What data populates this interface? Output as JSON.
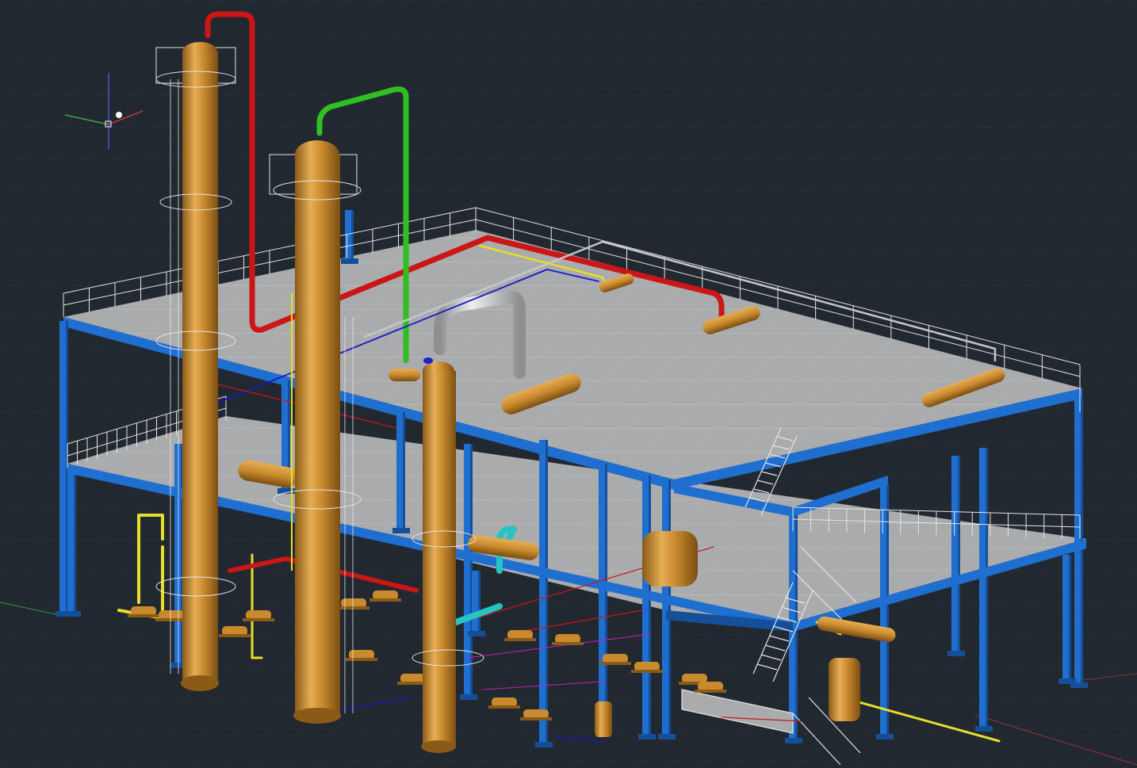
{
  "viewport": {
    "background": "#212830",
    "grid_color": "#2c3540"
  },
  "colors": {
    "vessel": "#c98a2e",
    "vessel_shade": "#8a5a17",
    "vessel_light": "#e6ae55",
    "steel": "#1f6fd1",
    "steel_dark": "#164f99",
    "deck": "#a9abad",
    "deck_grate": "#bfc1c3",
    "railing": "#e4e4e4",
    "pipe_red": "#cc1616",
    "pipe_green": "#2fbf22",
    "pipe_grey": "#c4c6c8",
    "pipe_yellow": "#e6de2a",
    "pipe_blue": "#1818c8",
    "pipe_cyan": "#29c3c3",
    "ucs_x": "#d23a3a",
    "ucs_y": "#3ac23a",
    "ucs_z": "#5a5ae6"
  },
  "icons": {
    "ucs": "ucs-crosshair-icon"
  }
}
